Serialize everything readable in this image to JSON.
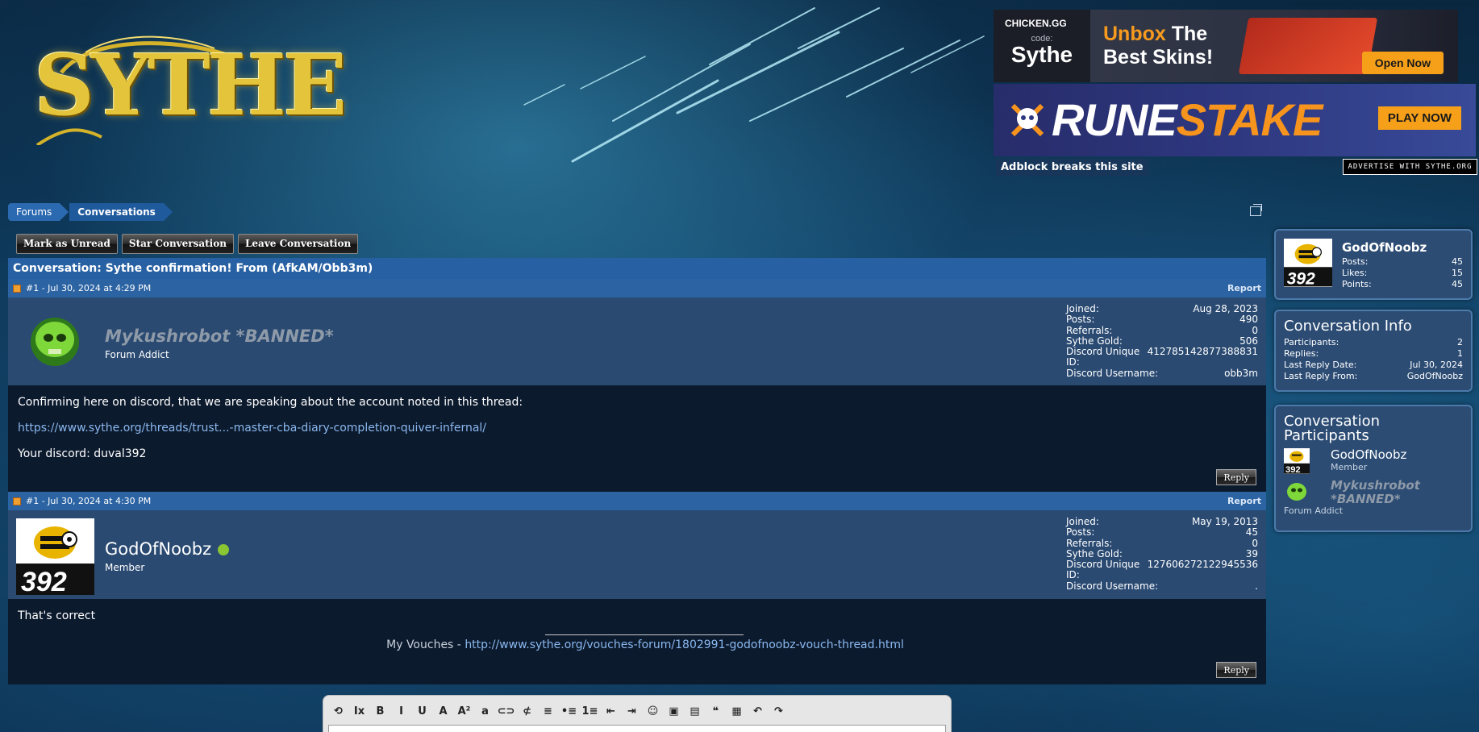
{
  "site": {
    "logo_text": "SYTHE"
  },
  "ads": {
    "ad1": {
      "brand": "CHICKEN.GG",
      "code_label": "code:",
      "code_value": "Sythe",
      "headline_orange": "Unbox",
      "headline_rest1": " The",
      "headline_rest2": "Best Skins!",
      "button": "Open Now"
    },
    "ad2": {
      "title_white": "RUNE",
      "title_orange": "STAKE",
      "button": "PLAY NOW"
    },
    "adblock_notice": "Adblock breaks this site",
    "advertise": "ADVERTISE WITH SYTHE.ORG"
  },
  "breadcrumb": [
    "Forums",
    "Conversations"
  ],
  "actions": [
    "Mark as Unread",
    "Star Conversation",
    "Leave Conversation"
  ],
  "conversation": {
    "title": "Conversation: Sythe confirmation! From (AfkAM/Obb3m)",
    "posts": [
      {
        "header": "#1 - Jul 30, 2024 at 4:29 PM",
        "report": "Report",
        "username": "Mykushrobot *BANNED*",
        "user_title": "Forum Addict",
        "stats": [
          [
            "Joined:",
            "Aug 28, 2023"
          ],
          [
            "Posts:",
            "490"
          ],
          [
            "Referrals:",
            "0"
          ],
          [
            "Sythe Gold:",
            "506"
          ],
          [
            "Discord Unique ID:",
            "412785142877388831"
          ],
          [
            "Discord Username:",
            "obb3m"
          ]
        ],
        "body_line1": "Confirming here on discord, that we are speaking about the account noted in this thread:",
        "body_link": "https://www.sythe.org/threads/trust...-master-cba-diary-completion-quiver-infernal/",
        "body_line3": "Your discord: duval392",
        "reply": "Reply"
      },
      {
        "header": "#1 - Jul 30, 2024 at 4:30 PM",
        "report": "Report",
        "username": "GodOfNoobz",
        "user_title": "Member",
        "stats": [
          [
            "Joined:",
            "May 19, 2013"
          ],
          [
            "Posts:",
            "45"
          ],
          [
            "Referrals:",
            "0"
          ],
          [
            "Sythe Gold:",
            "39"
          ],
          [
            "Discord Unique ID:",
            "127606272122945536"
          ],
          [
            "Discord Username:",
            "."
          ]
        ],
        "body_line1": "That's correct",
        "signature_label": "My Vouches - ",
        "signature_link": "http://www.sythe.org/vouches-forum/1802991-godofnoobz-vouch-thread.html",
        "reply": "Reply"
      }
    ]
  },
  "sidebar": {
    "profile": {
      "name": "GodOfNoobz",
      "stats": [
        [
          "Posts:",
          "45"
        ],
        [
          "Likes:",
          "15"
        ],
        [
          "Points:",
          "45"
        ]
      ]
    },
    "info": {
      "title": "Conversation Info",
      "rows": [
        [
          "Participants:",
          "2"
        ],
        [
          "Replies:",
          "1"
        ],
        [
          "Last Reply Date:",
          "Jul 30, 2024"
        ],
        [
          "Last Reply From:",
          "GodOfNoobz"
        ]
      ]
    },
    "participants": {
      "title": "Conversation Participants",
      "list": [
        {
          "name": "GodOfNoobz",
          "title": "Member"
        },
        {
          "name": "Mykushrobot *BANNED*",
          "title": "Forum Addict"
        }
      ]
    }
  },
  "editor": {
    "toolbar_icons": [
      "remove-format-icon",
      "clear-format-icon",
      "bold-icon",
      "italic-icon",
      "underline-icon",
      "font-color-icon",
      "font-size-icon",
      "font-family-icon",
      "link-icon",
      "unlink-icon",
      "align-icon",
      "bullet-list-icon",
      "number-list-icon",
      "outdent-icon",
      "indent-icon",
      "smilie-icon",
      "image-icon",
      "media-icon",
      "quote-icon",
      "save-draft-icon",
      "undo-icon",
      "redo-icon"
    ],
    "toolbar_glyphs": [
      "⟲",
      "Ix",
      "B",
      "I",
      "U",
      "A",
      "A²",
      "a",
      "⊂⊃",
      "⊄",
      "≡",
      "•≡",
      "1≡",
      "⇤",
      "⇥",
      "☺",
      "▣",
      "▤",
      "❝",
      "▦",
      "↶",
      "↷"
    ]
  }
}
